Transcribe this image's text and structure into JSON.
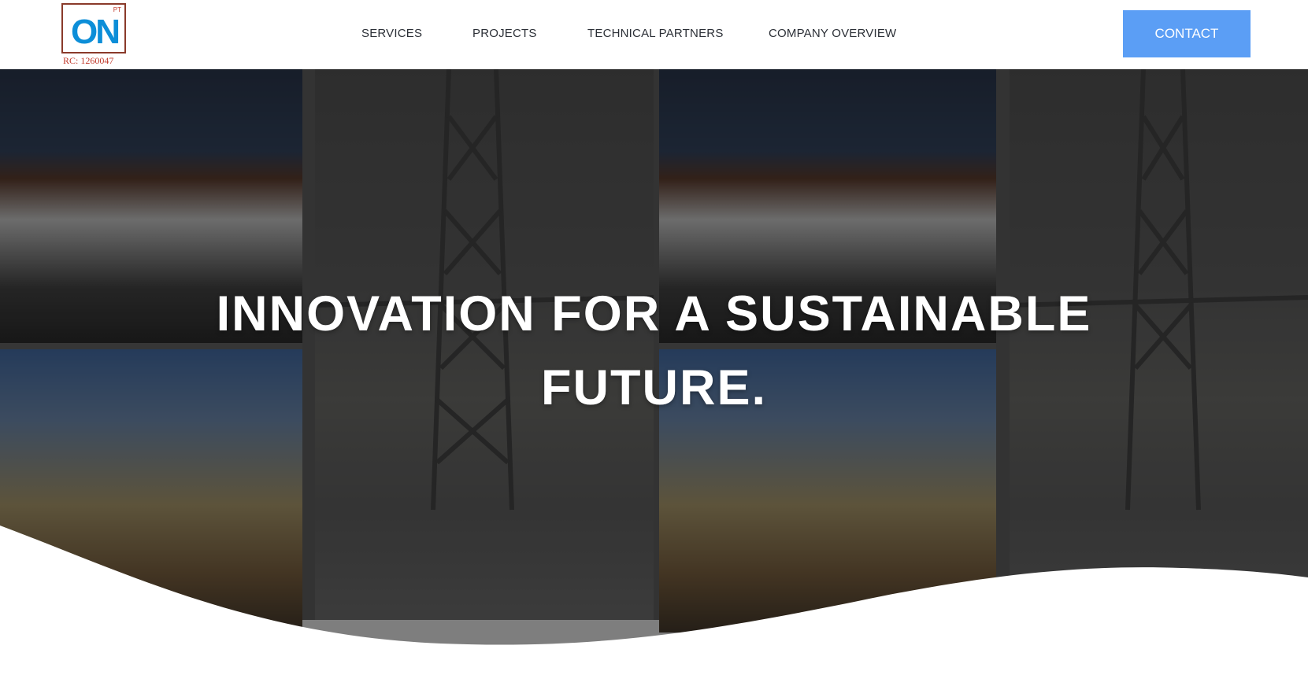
{
  "header": {
    "logo": {
      "mark_text": "ON",
      "superscript": "PT",
      "rc_text": "RC: 1260047"
    },
    "nav": [
      {
        "label": "SERVICES"
      },
      {
        "label": "PROJECTS"
      },
      {
        "label": "TECHNICAL PARTNERS"
      },
      {
        "label": "COMPANY OVERVIEW"
      }
    ],
    "contact_label": "CONTACT"
  },
  "hero": {
    "title_line1": "INNOVATION FOR A SUSTAINABLE",
    "title_line2": "FUTURE."
  },
  "colors": {
    "accent": "#5b9ef5",
    "logo_blue": "#0c8ed8",
    "logo_red": "#c0392b",
    "nav_text": "#2b2f36"
  }
}
